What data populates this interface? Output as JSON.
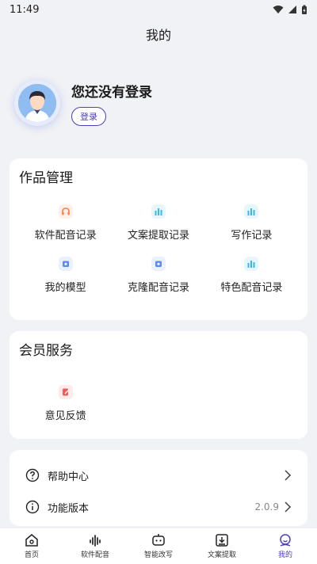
{
  "status": {
    "time": "11:49"
  },
  "header": {
    "title": "我的"
  },
  "profile": {
    "name": "您还没有登录",
    "login_label": "登录"
  },
  "works": {
    "title": "作品管理",
    "items": [
      {
        "label": "软件配音记录",
        "icon": "headphones-icon",
        "color": "#ff7a45"
      },
      {
        "label": "文案提取记录",
        "icon": "bars-icon",
        "color": "#38b8e8"
      },
      {
        "label": "写作记录",
        "icon": "bars-icon",
        "color": "#38b8e8"
      },
      {
        "label": "我的模型",
        "icon": "model-icon",
        "color": "#5b8def"
      },
      {
        "label": "克隆配音记录",
        "icon": "clone-icon",
        "color": "#5b8def"
      },
      {
        "label": "特色配音记录",
        "icon": "bars-icon",
        "color": "#38b8e8"
      }
    ]
  },
  "member": {
    "title": "会员服务",
    "items": [
      {
        "label": "意见反馈",
        "icon": "feedback-icon",
        "color": "#f05a5a"
      }
    ]
  },
  "menu": {
    "help_label": "帮助中心",
    "version_label": "功能版本",
    "version_value": "2.0.9"
  },
  "tabs": [
    {
      "label": "首页",
      "icon": "home-icon"
    },
    {
      "label": "软件配音",
      "icon": "waveform-icon"
    },
    {
      "label": "智能改写",
      "icon": "robot-icon"
    },
    {
      "label": "文案提取",
      "icon": "download-box-icon"
    },
    {
      "label": "我的",
      "icon": "user-face-icon",
      "active": true
    }
  ],
  "colors": {
    "accent": "#4b3fb8",
    "background": "#f1f2f6"
  }
}
